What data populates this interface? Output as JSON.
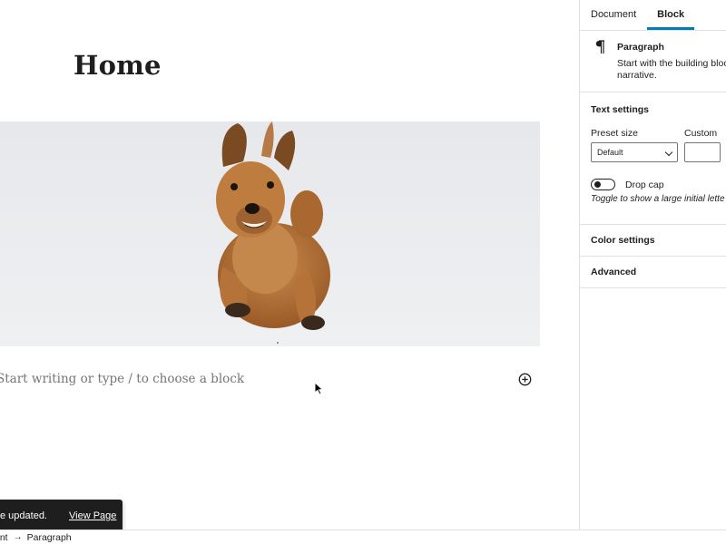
{
  "editor": {
    "page_title": "Home",
    "paragraph_placeholder": "Start writing or type / to choose a block",
    "add_block_icon": "plus-circle-icon",
    "image_subject": "running-dog-photo"
  },
  "snackbar": {
    "message": "e updated.",
    "action_label": "View Page"
  },
  "footer": {
    "breadcrumbs": [
      "ent",
      "Paragraph"
    ],
    "separator_icon": "arrow-right-icon"
  },
  "sidebar": {
    "tabs": [
      {
        "label": "Document",
        "active": false
      },
      {
        "label": "Block",
        "active": true
      }
    ],
    "block_card": {
      "icon": "paragraph-icon",
      "title": "Paragraph",
      "description_line1": "Start with the building bloc",
      "description_line2": "narrative."
    },
    "text_settings": {
      "title": "Text settings",
      "preset_size_label": "Preset size",
      "custom_label": "Custom",
      "preset_value": "Default",
      "drop_cap_label": "Drop cap",
      "drop_cap_help": "Toggle to show a large initial lette"
    },
    "color_settings_title": "Color settings",
    "advanced_title": "Advanced"
  },
  "colors": {
    "accent": "#007cba",
    "snackbar_bg": "#1e1e1e",
    "placeholder_text": "#757575"
  }
}
